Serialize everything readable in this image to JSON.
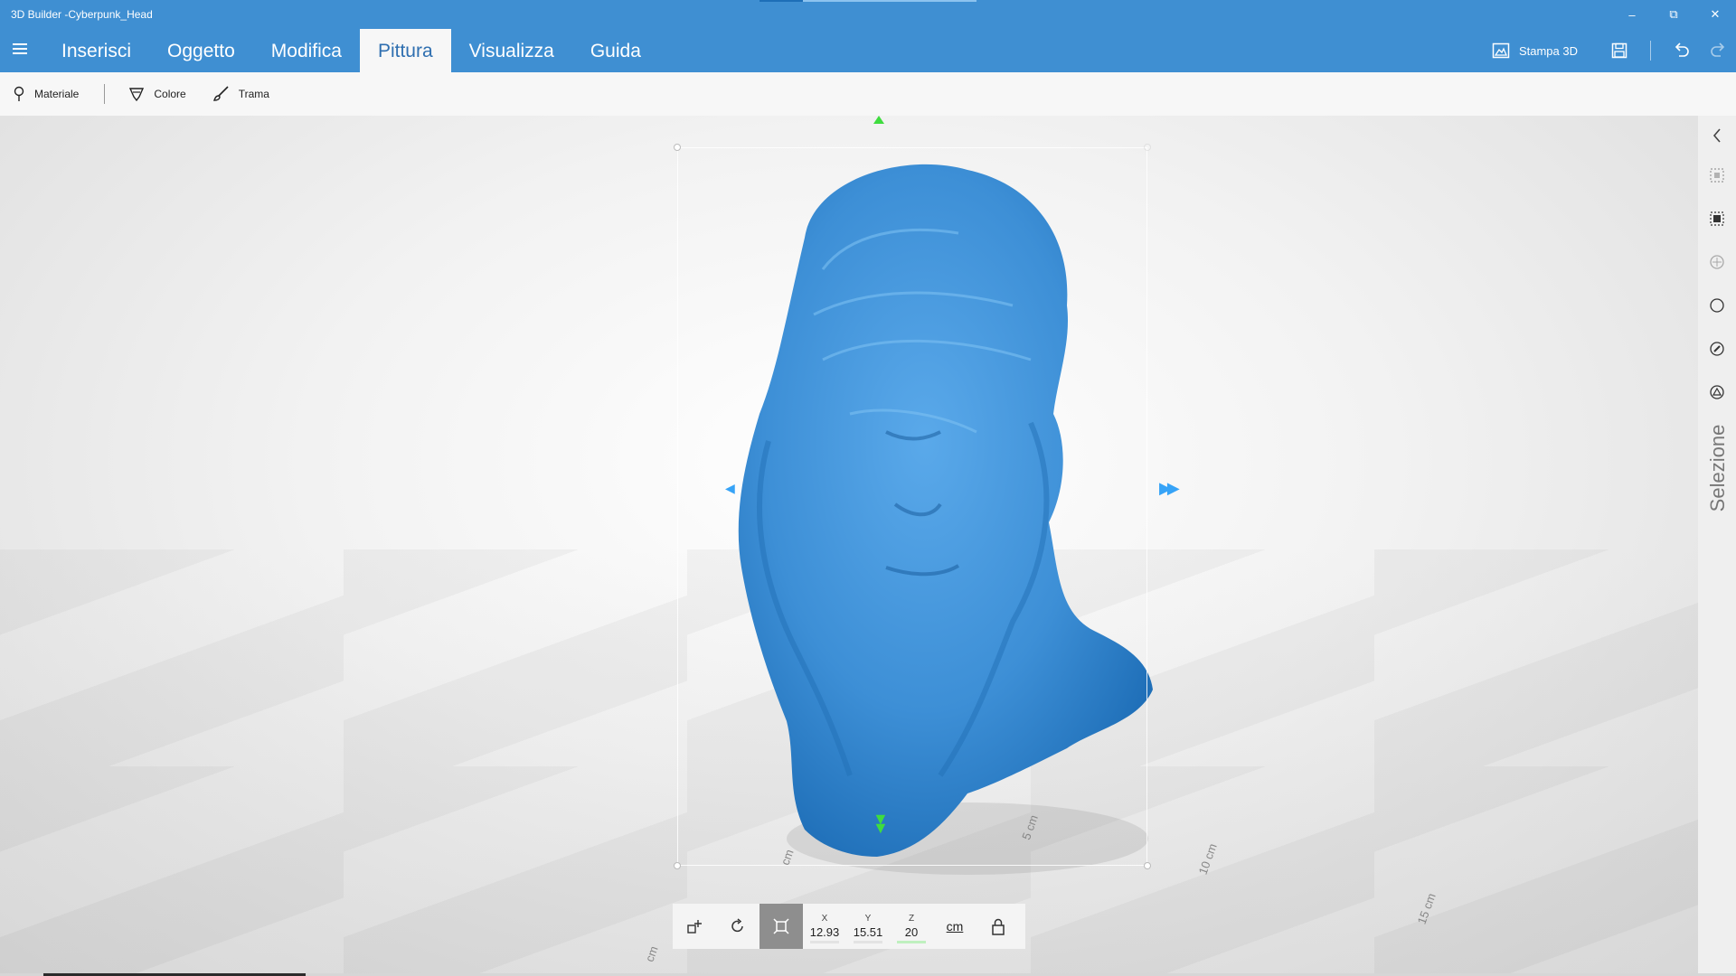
{
  "window": {
    "title": "3D Builder -Cyberpunk_Head",
    "loading_progress": 0.2,
    "minimize": "–",
    "maximize": "⧉",
    "close": "✕"
  },
  "ribbon": {
    "tabs": [
      {
        "label": "Inserisci"
      },
      {
        "label": "Oggetto"
      },
      {
        "label": "Modifica"
      },
      {
        "label": "Pittura",
        "active": true
      },
      {
        "label": "Visualizza"
      },
      {
        "label": "Guida"
      }
    ],
    "print_label": "Stampa 3D"
  },
  "toolbar": {
    "material_label": "Materiale",
    "color_label": "Colore",
    "texture_label": "Trama"
  },
  "viewport": {
    "model_color": "#3d8fd6",
    "rulers": {
      "r5": "5 cm",
      "r10": "10 cm",
      "r15": "15 cm",
      "left": "cm",
      "near": "cm"
    }
  },
  "transform": {
    "x_label": "X",
    "x_value": "12.93",
    "y_label": "Y",
    "y_value": "15.51",
    "z_label": "Z",
    "z_value": "20",
    "unit": "cm"
  },
  "side_panel": {
    "label": "Selezione"
  },
  "colors": {
    "accent": "#3f8fd2",
    "tab_active_text": "#2f6fb0",
    "axis_x": "#36a3f7",
    "axis_z": "#3fdc3f"
  }
}
